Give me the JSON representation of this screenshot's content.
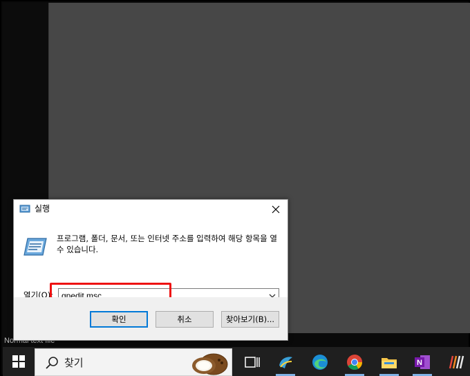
{
  "dialog": {
    "title": "실행",
    "description": "프로그램, 폴더, 문서, 또는 인터넷 주소를 입력하여 해당 항목을 열 수 있습니다.",
    "open_label": "열기(O):",
    "open_value": "gpedit.msc",
    "ok_label": "확인",
    "cancel_label": "취소",
    "browse_label": "찾아보기(B)..."
  },
  "status_text": "Normal text file",
  "taskbar": {
    "search_text": "찾기",
    "apps": [
      {
        "name": "task-view-icon"
      },
      {
        "name": "python-shell-icon"
      },
      {
        "name": "edge-icon"
      },
      {
        "name": "chrome-icon"
      },
      {
        "name": "file-explorer-icon"
      },
      {
        "name": "onenote-icon"
      },
      {
        "name": "app-stripes-icon"
      }
    ]
  },
  "colors": {
    "desktop": "#474747",
    "taskbar": "#1f1f1f",
    "highlight": "#ee1111",
    "accent": "#0078d7"
  }
}
